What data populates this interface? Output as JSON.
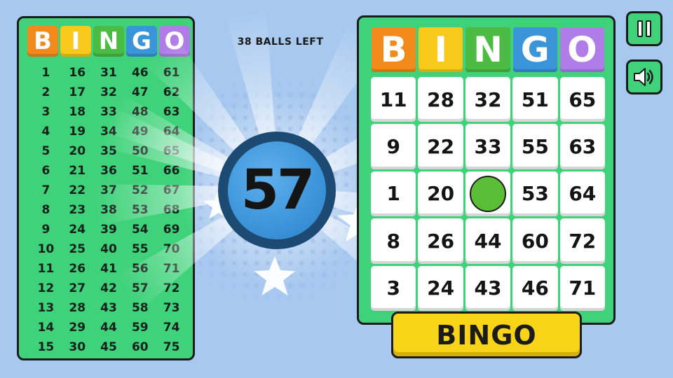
{
  "header": {
    "letters": [
      "B",
      "I",
      "N",
      "G",
      "O"
    ],
    "letter_colors": [
      "#f28a1b",
      "#f8c91a",
      "#4cbb44",
      "#3a95d8",
      "#b07ce8"
    ]
  },
  "called_board": {
    "columns": [
      [
        "1",
        "2",
        "3",
        "4",
        "5",
        "6",
        "7",
        "8",
        "9",
        "10",
        "11",
        "12",
        "13",
        "14",
        "15"
      ],
      [
        "16",
        "17",
        "18",
        "19",
        "20",
        "21",
        "22",
        "23",
        "24",
        "25",
        "26",
        "27",
        "28",
        "29",
        "30"
      ],
      [
        "31",
        "32",
        "33",
        "34",
        "35",
        "36",
        "37",
        "38",
        "39",
        "40",
        "41",
        "42",
        "43",
        "44",
        "45"
      ],
      [
        "46",
        "47",
        "48",
        "49",
        "50",
        "51",
        "52",
        "53",
        "54",
        "55",
        "56",
        "57",
        "58",
        "59",
        "60"
      ],
      [
        "61",
        "62",
        "63",
        "64",
        "65",
        "66",
        "67",
        "68",
        "69",
        "70",
        "71",
        "72",
        "73",
        "74",
        "75"
      ]
    ]
  },
  "status": {
    "balls_left": "38 BALLS LEFT",
    "current_ball": "57"
  },
  "player_card": {
    "rows": [
      [
        "11",
        "28",
        "32",
        "51",
        "65"
      ],
      [
        "9",
        "22",
        "33",
        "55",
        "63"
      ],
      [
        "1",
        "20",
        "",
        "53",
        "64"
      ],
      [
        "8",
        "26",
        "44",
        "60",
        "72"
      ],
      [
        "3",
        "24",
        "43",
        "46",
        "71"
      ]
    ],
    "marked": [
      [
        2,
        2
      ]
    ]
  },
  "buttons": {
    "bingo": "BINGO",
    "pause_icon": "pause-icon",
    "sound_icon": "speaker-icon"
  }
}
